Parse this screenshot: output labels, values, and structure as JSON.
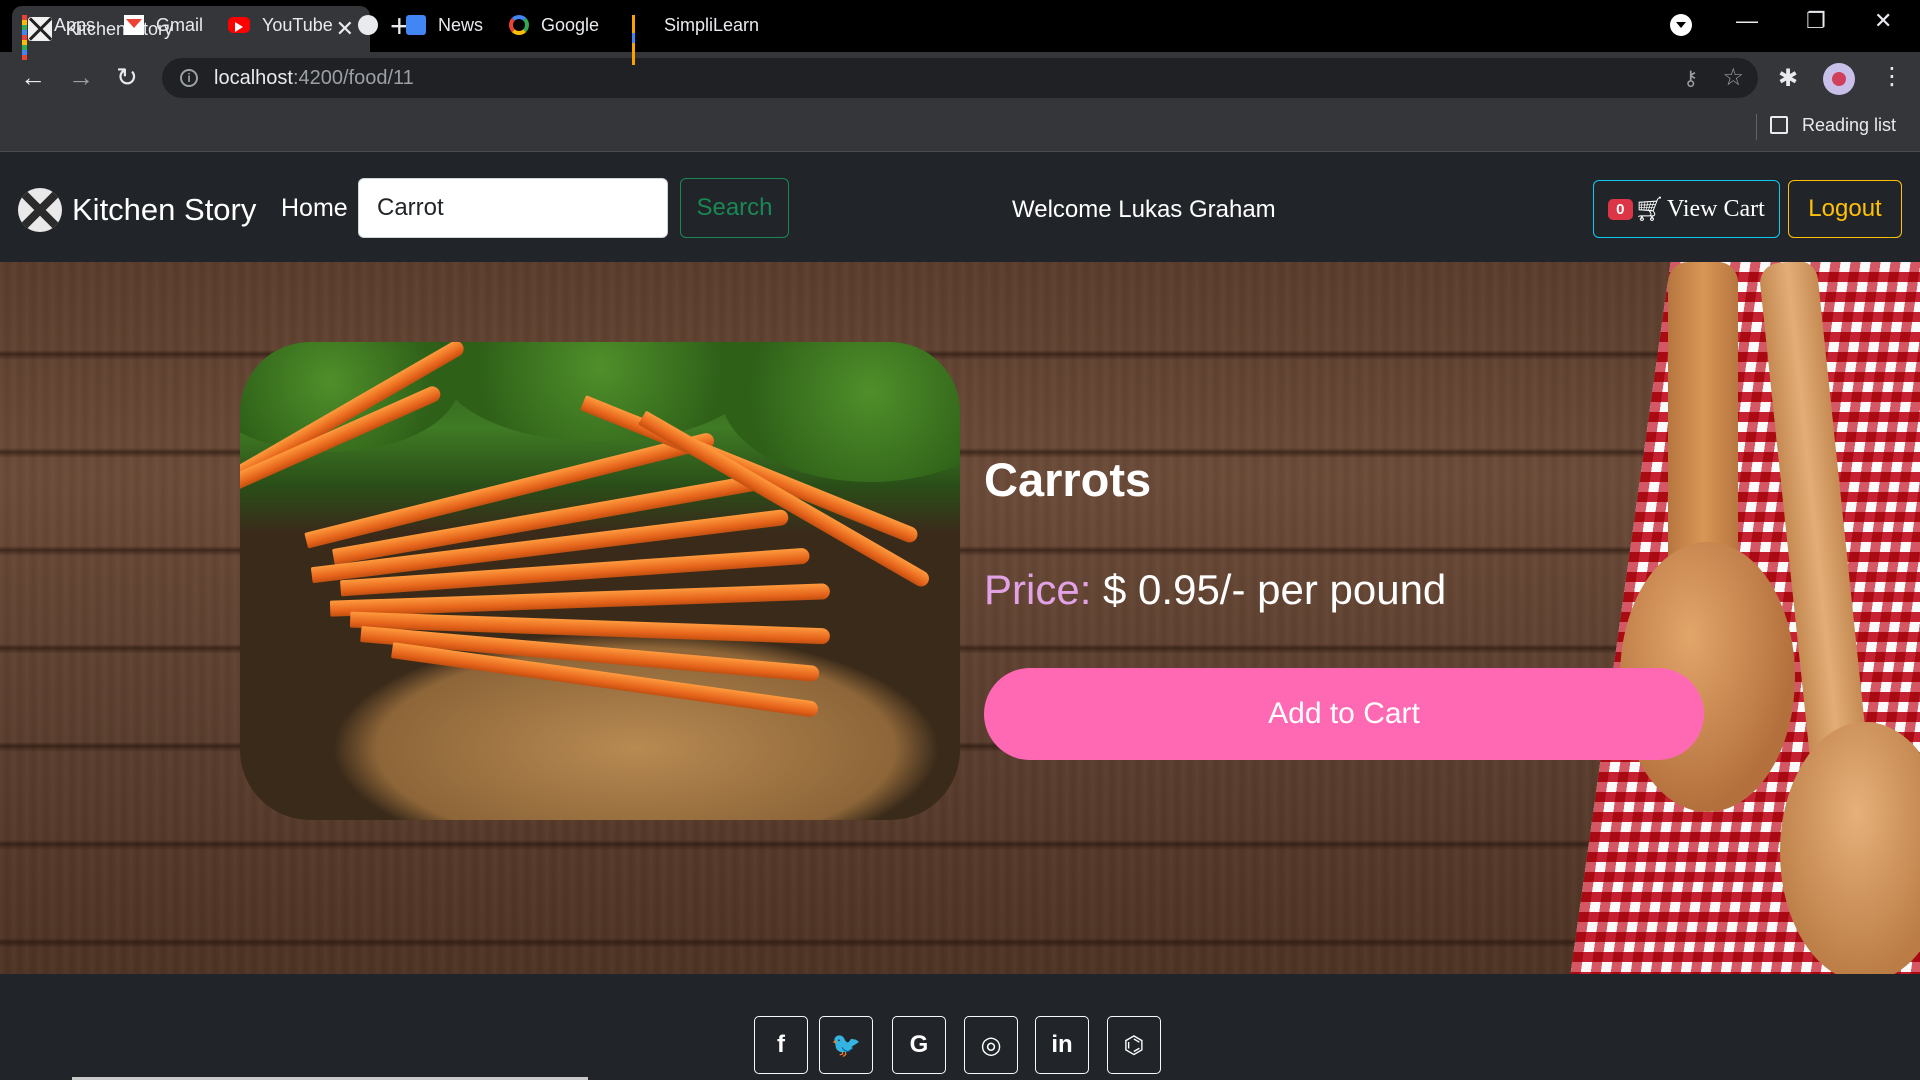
{
  "browser": {
    "tab_title": "Kitchen Story",
    "tab_close": "✕",
    "new_tab": "+",
    "url_host": "localhost",
    "url_rest": ":4200/food/11",
    "window": {
      "minimize": "—",
      "restore": "❐",
      "close": "✕"
    },
    "nav": {
      "back": "←",
      "forward": "→",
      "reload": "↻"
    },
    "bookmarks": [
      {
        "label": "Apps",
        "icon": "apps-grid-icon"
      },
      {
        "label": "Gmail",
        "icon": "gmail-icon"
      },
      {
        "label": "YouTube",
        "icon": "youtube-icon"
      },
      {
        "label": "",
        "icon": "globe-icon"
      },
      {
        "label": "News",
        "icon": "news-icon"
      },
      {
        "label": "Google",
        "icon": "google-icon"
      },
      {
        "label": "SimpliLearn",
        "icon": "simplilearn-icon"
      }
    ],
    "reading_list": "Reading list"
  },
  "site": {
    "brand": "Kitchen Story",
    "home": "Home",
    "search_value": "Carrot",
    "search_button": "Search",
    "welcome": "Welcome Lukas Graham",
    "cart_count": "0",
    "cart_label": "View Cart",
    "logout": "Logout"
  },
  "product": {
    "title": "Carrots",
    "price_label": "Price:",
    "price_value": " $ 0.95/- per pound",
    "add_to_cart": "Add to Cart"
  },
  "footer": {
    "social": [
      {
        "name": "facebook",
        "glyph": "f"
      },
      {
        "name": "twitter",
        "glyph": "🐦"
      },
      {
        "name": "google",
        "glyph": "G"
      },
      {
        "name": "instagram",
        "glyph": "◎"
      },
      {
        "name": "linkedin",
        "glyph": "in"
      },
      {
        "name": "github",
        "glyph": "⌬"
      }
    ]
  },
  "colors": {
    "accent_pink": "#ff69b4",
    "price_label": "#e3a2e6",
    "search_green": "#198754",
    "cart_cyan": "#0dcaf0",
    "logout_yellow": "#ffc107",
    "badge_red": "#dc3545"
  }
}
